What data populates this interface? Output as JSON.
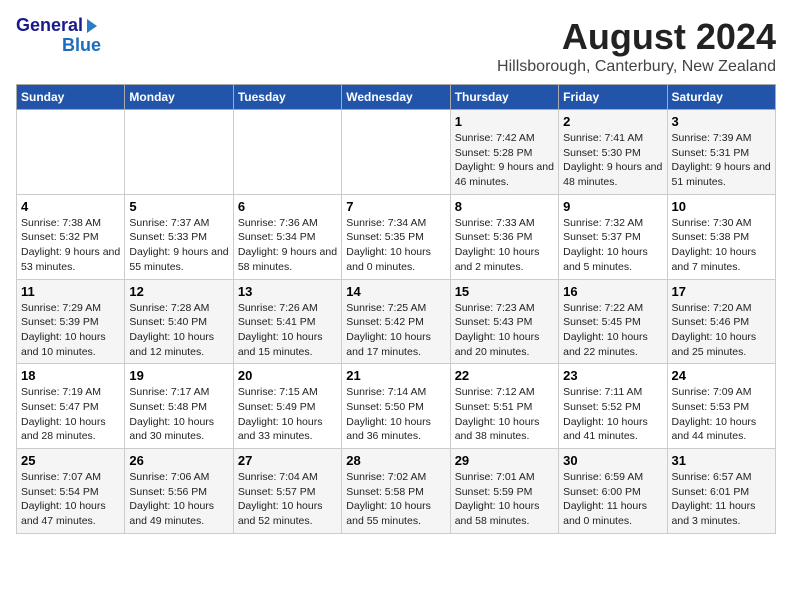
{
  "logo": {
    "line1": "General",
    "line2": "Blue"
  },
  "title": "August 2024",
  "subtitle": "Hillsborough, Canterbury, New Zealand",
  "days_of_week": [
    "Sunday",
    "Monday",
    "Tuesday",
    "Wednesday",
    "Thursday",
    "Friday",
    "Saturday"
  ],
  "weeks": [
    [
      {
        "day": "",
        "info": ""
      },
      {
        "day": "",
        "info": ""
      },
      {
        "day": "",
        "info": ""
      },
      {
        "day": "",
        "info": ""
      },
      {
        "day": "1",
        "info": "Sunrise: 7:42 AM\nSunset: 5:28 PM\nDaylight: 9 hours and 46 minutes."
      },
      {
        "day": "2",
        "info": "Sunrise: 7:41 AM\nSunset: 5:30 PM\nDaylight: 9 hours and 48 minutes."
      },
      {
        "day": "3",
        "info": "Sunrise: 7:39 AM\nSunset: 5:31 PM\nDaylight: 9 hours and 51 minutes."
      }
    ],
    [
      {
        "day": "4",
        "info": "Sunrise: 7:38 AM\nSunset: 5:32 PM\nDaylight: 9 hours and 53 minutes."
      },
      {
        "day": "5",
        "info": "Sunrise: 7:37 AM\nSunset: 5:33 PM\nDaylight: 9 hours and 55 minutes."
      },
      {
        "day": "6",
        "info": "Sunrise: 7:36 AM\nSunset: 5:34 PM\nDaylight: 9 hours and 58 minutes."
      },
      {
        "day": "7",
        "info": "Sunrise: 7:34 AM\nSunset: 5:35 PM\nDaylight: 10 hours and 0 minutes."
      },
      {
        "day": "8",
        "info": "Sunrise: 7:33 AM\nSunset: 5:36 PM\nDaylight: 10 hours and 2 minutes."
      },
      {
        "day": "9",
        "info": "Sunrise: 7:32 AM\nSunset: 5:37 PM\nDaylight: 10 hours and 5 minutes."
      },
      {
        "day": "10",
        "info": "Sunrise: 7:30 AM\nSunset: 5:38 PM\nDaylight: 10 hours and 7 minutes."
      }
    ],
    [
      {
        "day": "11",
        "info": "Sunrise: 7:29 AM\nSunset: 5:39 PM\nDaylight: 10 hours and 10 minutes."
      },
      {
        "day": "12",
        "info": "Sunrise: 7:28 AM\nSunset: 5:40 PM\nDaylight: 10 hours and 12 minutes."
      },
      {
        "day": "13",
        "info": "Sunrise: 7:26 AM\nSunset: 5:41 PM\nDaylight: 10 hours and 15 minutes."
      },
      {
        "day": "14",
        "info": "Sunrise: 7:25 AM\nSunset: 5:42 PM\nDaylight: 10 hours and 17 minutes."
      },
      {
        "day": "15",
        "info": "Sunrise: 7:23 AM\nSunset: 5:43 PM\nDaylight: 10 hours and 20 minutes."
      },
      {
        "day": "16",
        "info": "Sunrise: 7:22 AM\nSunset: 5:45 PM\nDaylight: 10 hours and 22 minutes."
      },
      {
        "day": "17",
        "info": "Sunrise: 7:20 AM\nSunset: 5:46 PM\nDaylight: 10 hours and 25 minutes."
      }
    ],
    [
      {
        "day": "18",
        "info": "Sunrise: 7:19 AM\nSunset: 5:47 PM\nDaylight: 10 hours and 28 minutes."
      },
      {
        "day": "19",
        "info": "Sunrise: 7:17 AM\nSunset: 5:48 PM\nDaylight: 10 hours and 30 minutes."
      },
      {
        "day": "20",
        "info": "Sunrise: 7:15 AM\nSunset: 5:49 PM\nDaylight: 10 hours and 33 minutes."
      },
      {
        "day": "21",
        "info": "Sunrise: 7:14 AM\nSunset: 5:50 PM\nDaylight: 10 hours and 36 minutes."
      },
      {
        "day": "22",
        "info": "Sunrise: 7:12 AM\nSunset: 5:51 PM\nDaylight: 10 hours and 38 minutes."
      },
      {
        "day": "23",
        "info": "Sunrise: 7:11 AM\nSunset: 5:52 PM\nDaylight: 10 hours and 41 minutes."
      },
      {
        "day": "24",
        "info": "Sunrise: 7:09 AM\nSunset: 5:53 PM\nDaylight: 10 hours and 44 minutes."
      }
    ],
    [
      {
        "day": "25",
        "info": "Sunrise: 7:07 AM\nSunset: 5:54 PM\nDaylight: 10 hours and 47 minutes."
      },
      {
        "day": "26",
        "info": "Sunrise: 7:06 AM\nSunset: 5:56 PM\nDaylight: 10 hours and 49 minutes."
      },
      {
        "day": "27",
        "info": "Sunrise: 7:04 AM\nSunset: 5:57 PM\nDaylight: 10 hours and 52 minutes."
      },
      {
        "day": "28",
        "info": "Sunrise: 7:02 AM\nSunset: 5:58 PM\nDaylight: 10 hours and 55 minutes."
      },
      {
        "day": "29",
        "info": "Sunrise: 7:01 AM\nSunset: 5:59 PM\nDaylight: 10 hours and 58 minutes."
      },
      {
        "day": "30",
        "info": "Sunrise: 6:59 AM\nSunset: 6:00 PM\nDaylight: 11 hours and 0 minutes."
      },
      {
        "day": "31",
        "info": "Sunrise: 6:57 AM\nSunset: 6:01 PM\nDaylight: 11 hours and 3 minutes."
      }
    ]
  ]
}
